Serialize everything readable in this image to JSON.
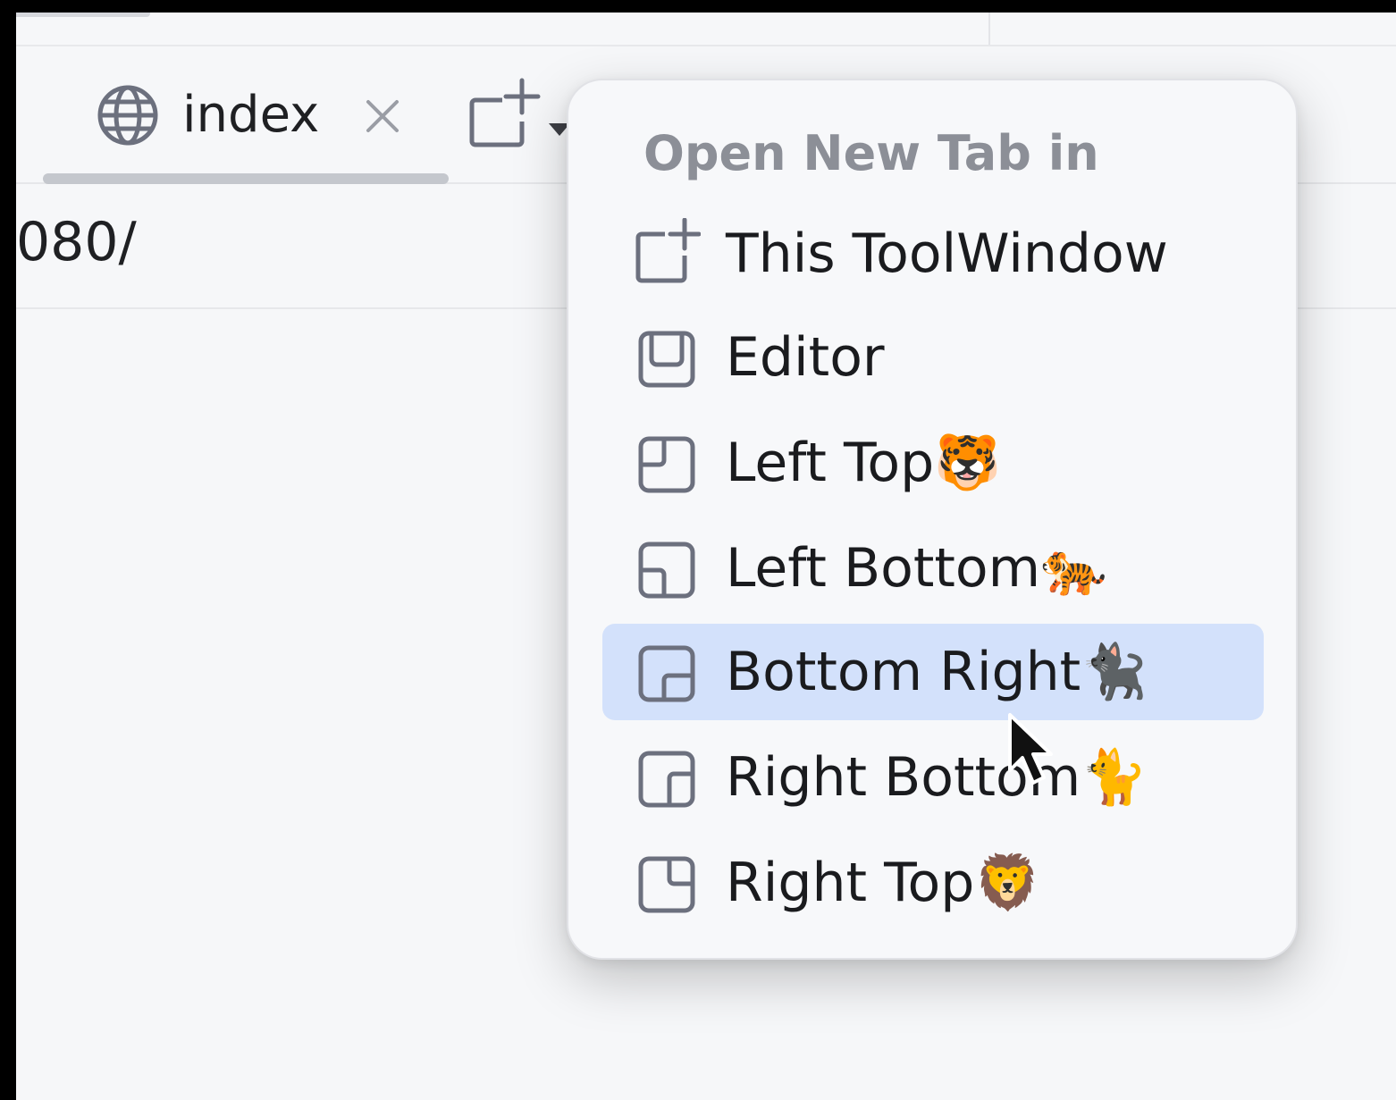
{
  "tab": {
    "label": "index",
    "icon": "globe-icon",
    "close_icon": "close-icon"
  },
  "address": {
    "text": "080/"
  },
  "new_tab_button": {
    "icon": "new-tab-icon",
    "dropdown_icon": "chevron-down-icon"
  },
  "popup": {
    "title": "Open New Tab in",
    "items": [
      {
        "label": "This ToolWindow",
        "icon": "new-tab-icon",
        "selected": false
      },
      {
        "label": "Editor",
        "icon": "editor-layout-icon",
        "selected": false
      },
      {
        "label": "Left Top🐯",
        "icon": "left-top-layout-icon",
        "selected": false
      },
      {
        "label": "Left Bottom🐅",
        "icon": "left-bottom-layout-icon",
        "selected": false
      },
      {
        "label": "Bottom Right🐈‍⬛",
        "icon": "bottom-right-layout-icon",
        "selected": true
      },
      {
        "label": "Right Bottom🐈",
        "icon": "right-bottom-layout-icon",
        "selected": false
      },
      {
        "label": "Right Top🦁",
        "icon": "right-top-layout-icon",
        "selected": false
      }
    ]
  },
  "colors": {
    "selected_bg": "#d3e1fb",
    "popup_bg": "#f7f8fa",
    "title_color": "#8c8f97",
    "icon_stroke": "#6c707e"
  }
}
